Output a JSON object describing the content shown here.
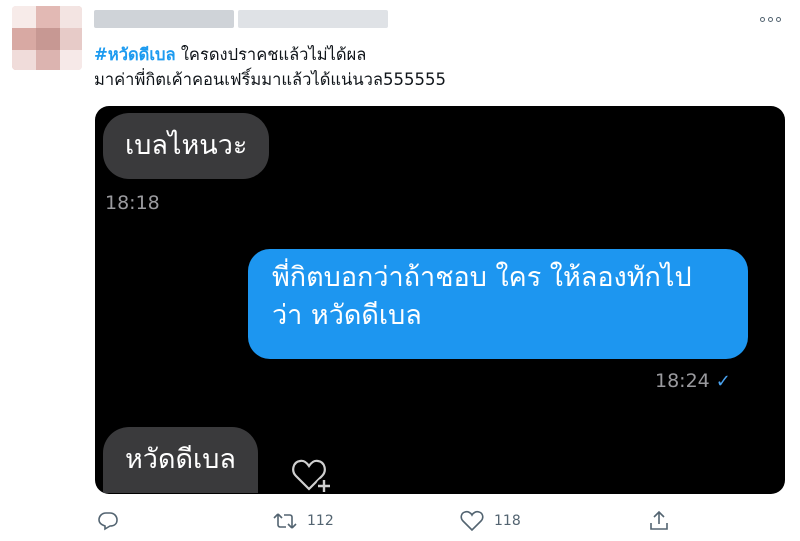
{
  "tweet": {
    "hashtag": "#หวัดดีเบล",
    "line1_rest": " ใครดงปราคชแล้วไม่ได้ผล",
    "line2": "มาค่าพี่กิตเค้าคอนเฟริ์มมาแล้วได้แน่นวล555555"
  },
  "chat": {
    "msg1": "เบลไหนวะ",
    "time1": "18:18",
    "msg2_line1": "พี่กิตบอกว่าถ้าชอบ ใคร ให้ลองทักไป",
    "msg2_line2": "ว่า หวัดดีเบล",
    "time2": "18:24",
    "check": "✓",
    "msg3": "หวัดดีเบล"
  },
  "actions": {
    "retweets": "112",
    "likes": "118"
  },
  "colors": {
    "hashtag": "#1d9bf0",
    "sent_bubble": "#1d96f0",
    "recv_bubble": "#3a3a3c",
    "chat_bg": "#000000"
  },
  "icons": [
    "reply-icon",
    "retweet-icon",
    "like-icon",
    "share-icon",
    "more-icon",
    "heart-plus-icon"
  ]
}
